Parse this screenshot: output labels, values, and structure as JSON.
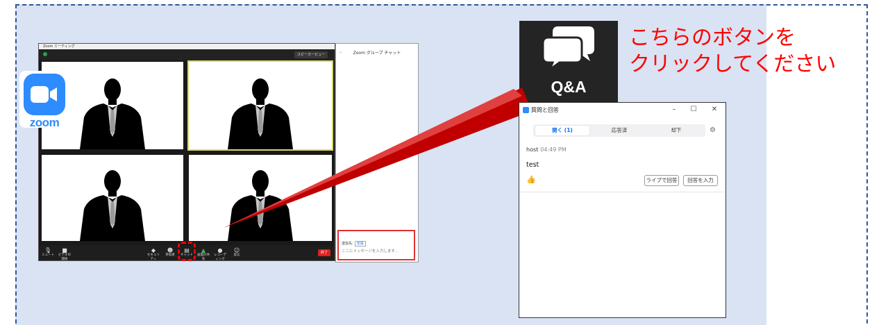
{
  "callout": {
    "line1": "こちらのボタンを",
    "line2": "クリックしてください"
  },
  "qa_button": {
    "label": "Q&A",
    "icon": "chat-bubbles-icon"
  },
  "zoom_logo": {
    "text": "zoom",
    "icon": "zoom-camera-icon"
  },
  "meeting_window": {
    "title": "Zoom ミーティング",
    "view_button": "スピーカービュー",
    "toolbar": [
      "ミュート",
      "ビデオの開始",
      "セキュリティ",
      "参加者",
      "チャット",
      "画面の共有",
      "レコーディング",
      "反応"
    ],
    "end_button": "終了"
  },
  "group_chat": {
    "title": "Zoom グループ チャット",
    "to_label": "送信先:",
    "to_value": "全員",
    "placeholder": "ここにメッセージを入力します..."
  },
  "qa_window": {
    "title": "質問と回答",
    "tabs": [
      {
        "label": "開く (1)",
        "active": true
      },
      {
        "label": "応答済",
        "active": false
      },
      {
        "label": "却下",
        "active": false
      }
    ],
    "question": {
      "author": "host",
      "time": "04:49 PM",
      "text": "test"
    },
    "answer_live_button": "ライブで回答",
    "type_answer_button": "回答を入力"
  },
  "colors": {
    "callout": "#ff0000",
    "zoom_blue": "#2d8cff",
    "frame_blue": "#2f5597",
    "background": "#d9e3f3",
    "pointer": "#c00000"
  }
}
